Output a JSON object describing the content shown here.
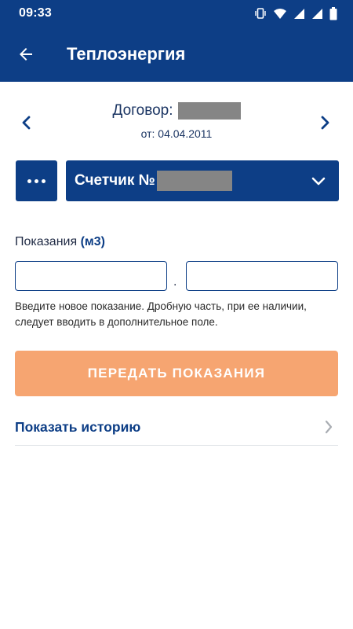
{
  "status_bar": {
    "time": "09:33",
    "icons": [
      "vibrate-icon",
      "wifi-icon",
      "signal-icon",
      "signal-icon",
      "battery-icon"
    ]
  },
  "app_bar": {
    "title": "Теплоэнергия",
    "back_icon": "arrow-left-icon"
  },
  "contract": {
    "label": "Договор:",
    "date": "от: 04.04.2011"
  },
  "meter": {
    "label": "Счетчик №",
    "more_icon": "more-dots-icon",
    "dropdown_icon": "chevron-down-icon"
  },
  "readings": {
    "label": "Показания",
    "unit": "(м3)",
    "integer_value": "",
    "fraction_value": "",
    "separator": ".",
    "hint": "Введите новое показание. Дробную часть, при ее наличии, следует вводить в дополнительное поле."
  },
  "submit": {
    "label": "ПЕРЕДАТЬ ПОКАЗАНИЯ"
  },
  "history": {
    "label": "Показать историю"
  },
  "colors": {
    "primary": "#0d3e86",
    "submit_disabled": "#f6a571",
    "text_dark": "#1f2a44",
    "redaction": "#858585"
  }
}
